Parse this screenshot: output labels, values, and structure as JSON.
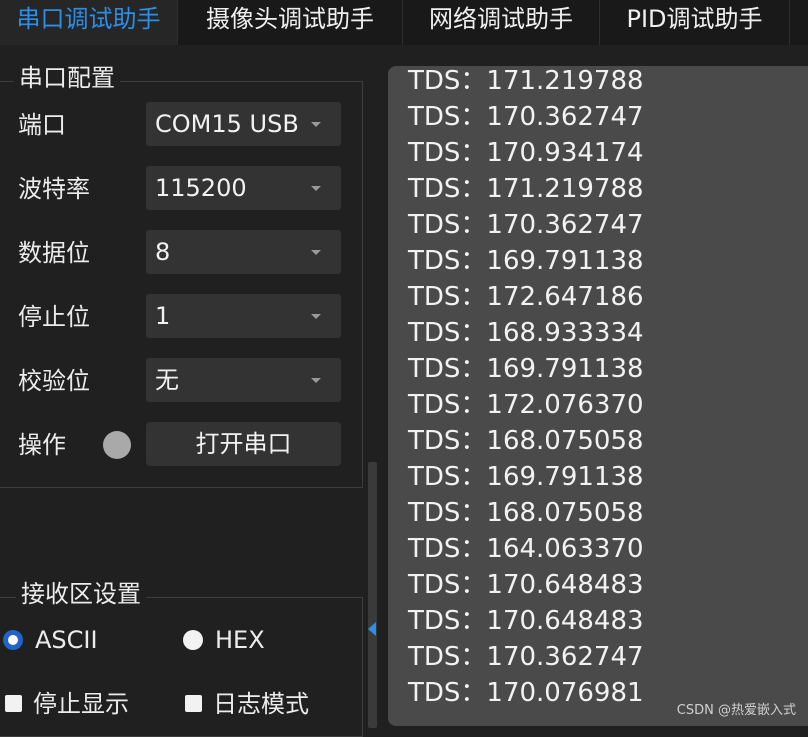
{
  "tabs": [
    {
      "label": "串口调试助手",
      "active": true
    },
    {
      "label": "摄像头调试助手",
      "active": false
    },
    {
      "label": "网络调试助手",
      "active": false
    },
    {
      "label": "PID调试助手",
      "active": false
    }
  ],
  "serial_config": {
    "title": "串口配置",
    "port": {
      "label": "端口",
      "value": "COM15 USB"
    },
    "baud": {
      "label": "波特率",
      "value": "115200"
    },
    "databits": {
      "label": "数据位",
      "value": "8"
    },
    "stopbits": {
      "label": "停止位",
      "value": "1"
    },
    "parity": {
      "label": "校验位",
      "value": "无"
    },
    "operation": {
      "label": "操作",
      "button": "打开串口",
      "status_color": "#a9a9a9"
    }
  },
  "receive_settings": {
    "title": "接收区设置",
    "ascii": {
      "label": "ASCII",
      "checked": true
    },
    "hex": {
      "label": "HEX",
      "checked": false
    },
    "stop_display": {
      "label": "停止显示",
      "checked": false
    },
    "log_mode": {
      "label": "日志模式",
      "checked": false
    }
  },
  "receive_lines": [
    "TDS：171.219788",
    "TDS：170.362747",
    "TDS：170.934174",
    "TDS：171.219788",
    "TDS：170.362747",
    "TDS：169.791138",
    "TDS：172.647186",
    "TDS：168.933334",
    "TDS：169.791138",
    "TDS：172.076370",
    "TDS：168.075058",
    "TDS：169.791138",
    "TDS：168.075058",
    "TDS：164.063370",
    "TDS：170.648483",
    "TDS：170.648483",
    "TDS：170.362747",
    "TDS：170.076981"
  ],
  "watermark": "CSDN @热爱嵌入式",
  "colors": {
    "accent": "#2b8ee8",
    "background": "#202020",
    "receive_bg": "#4a4a4a"
  }
}
